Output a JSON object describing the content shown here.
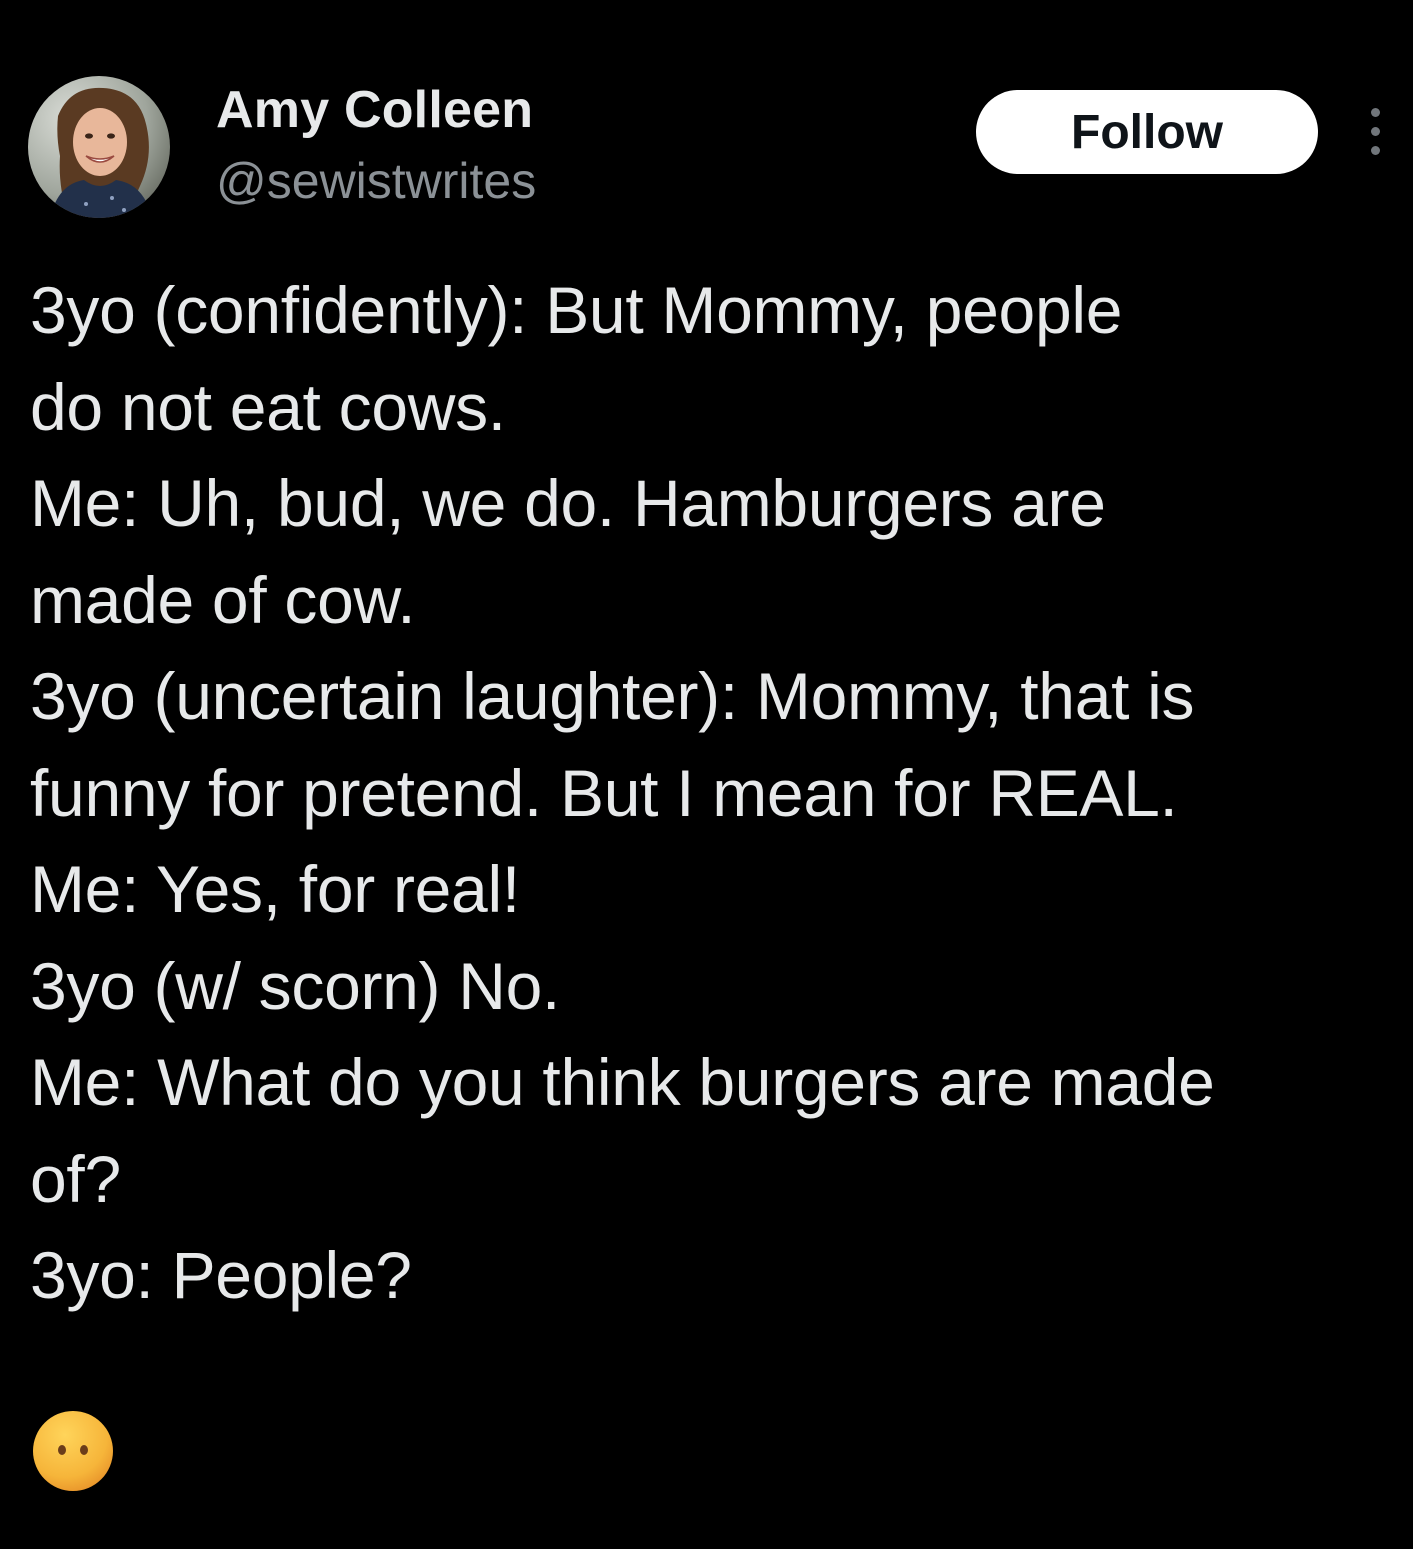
{
  "author": {
    "name": "Amy Colleen",
    "handle": "@sewistwrites",
    "avatar": "profile-photo"
  },
  "actions": {
    "follow_label": "Follow",
    "more_icon": "vertical-ellipsis-icon"
  },
  "tweet": {
    "lines": [
      "3yo (confidently): But Mommy, people",
      "do not eat cows.",
      "Me: Uh, bud, we do. Hamburgers are",
      "made of cow.",
      "3yo (uncertain laughter): Mommy, that is",
      "funny for pretend. But I mean for REAL.",
      "Me: Yes, for real!",
      "3yo (w/ scorn) No.",
      "Me: What do you think burgers are made",
      "of?",
      "3yo: People?"
    ],
    "emoji": "face-without-mouth-emoji"
  },
  "colors": {
    "background": "#000000",
    "text": "#e7e9ea",
    "secondary_text": "#8b9196",
    "button_bg": "#ffffff",
    "button_text": "#0f1419"
  }
}
